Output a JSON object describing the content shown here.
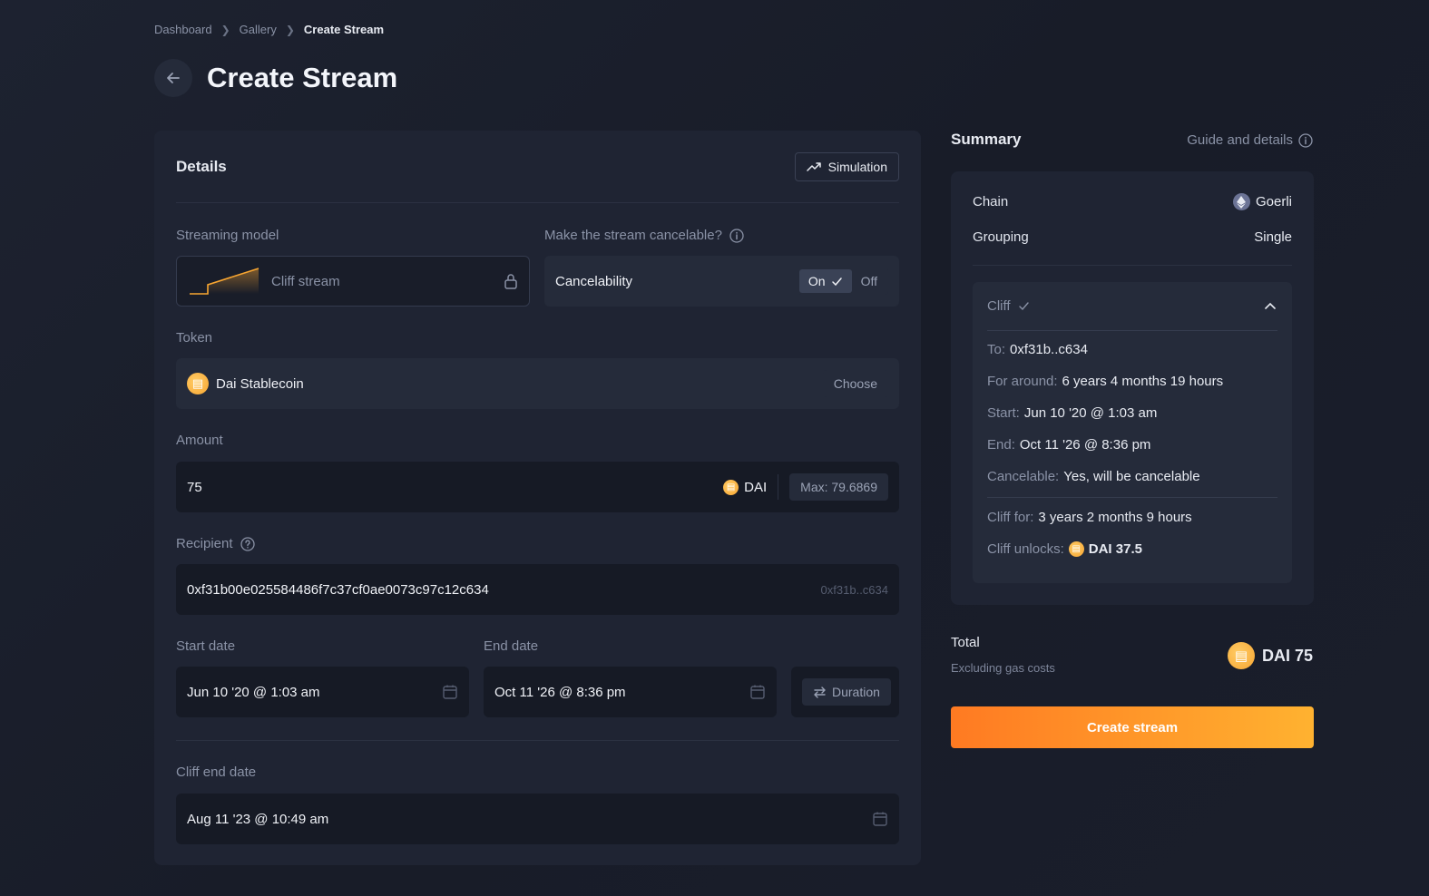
{
  "breadcrumb": {
    "items": [
      "Dashboard",
      "Gallery"
    ],
    "current": "Create Stream"
  },
  "page_title": "Create Stream",
  "details": {
    "title": "Details",
    "simulation_label": "Simulation",
    "streaming_model_label": "Streaming model",
    "streaming_model_value": "Cliff stream",
    "cancelable_label": "Make the stream cancelable?",
    "cancelability_label": "Cancelability",
    "toggle_on": "On",
    "toggle_off": "Off",
    "token_label": "Token",
    "token_value": "Dai Stablecoin",
    "choose_label": "Choose",
    "amount_label": "Amount",
    "amount_value": "75",
    "amount_token": "DAI",
    "max_label": "Max: 79.6869",
    "recipient_label": "Recipient",
    "recipient_value": "0xf31b00e025584486f7c37cf0ae0073c97c12c634",
    "recipient_short": "0xf31b..c634",
    "start_date_label": "Start date",
    "start_date_value": "Jun 10 '20 @ 1:03 am",
    "end_date_label": "End date",
    "end_date_value": "Oct 11 '26 @ 8:36 pm",
    "duration_label": "Duration",
    "cliff_end_label": "Cliff end date",
    "cliff_end_value": "Aug 11 '23 @ 10:49 am"
  },
  "summary": {
    "title": "Summary",
    "guide_label": "Guide and details",
    "chain_key": "Chain",
    "chain_value": "Goerli",
    "grouping_key": "Grouping",
    "grouping_value": "Single",
    "cliff_title": "Cliff",
    "to_key": "To:",
    "to_value": "0xf31b..c634",
    "for_key": "For around:",
    "for_value": "6 years 4 months 19 hours",
    "start_key": "Start:",
    "start_value": "Jun 10 '20 @ 1:03 am",
    "end_key": "End:",
    "end_value": "Oct 11 '26 @ 8:36 pm",
    "cancelable_key": "Cancelable:",
    "cancelable_value": "Yes, will be cancelable",
    "cliff_for_key": "Cliff for:",
    "cliff_for_value": "3 years 2 months 9 hours",
    "cliff_unlocks_key": "Cliff unlocks:",
    "cliff_unlocks_value": "DAI 37.5",
    "total_label": "Total",
    "total_sub": "Excluding gas costs",
    "total_value": "DAI 75",
    "create_label": "Create stream"
  },
  "colors": {
    "accent_start": "#ff7a22",
    "accent_end": "#ffb230",
    "dai": "#f7a531"
  }
}
